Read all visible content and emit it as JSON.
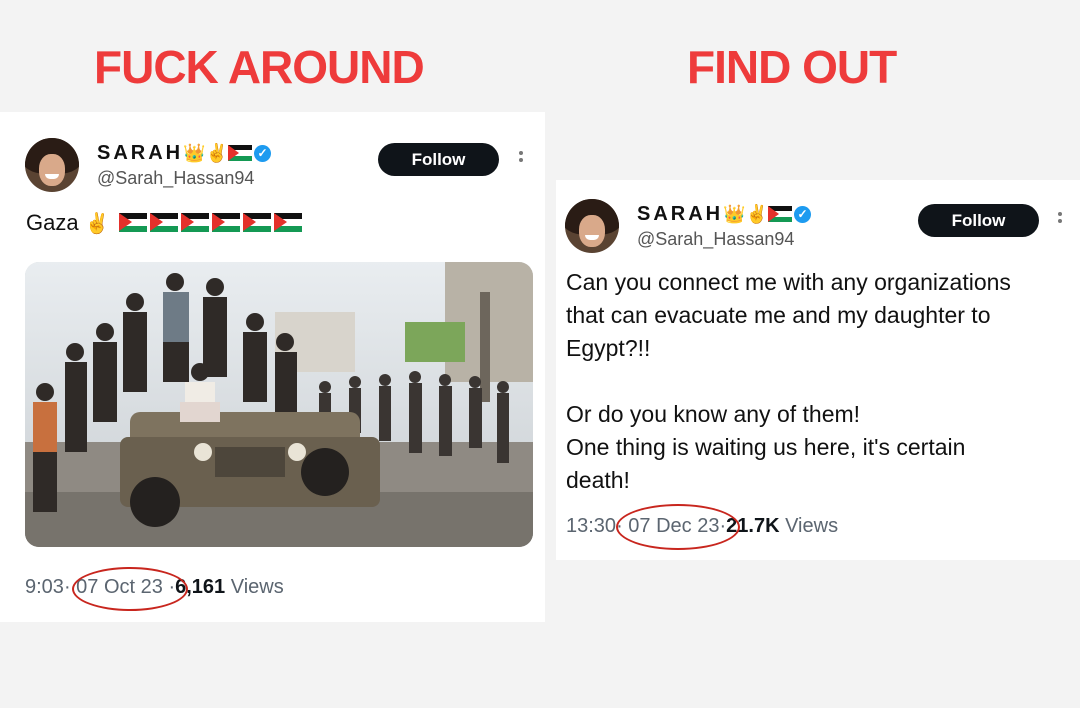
{
  "headlines": {
    "left": "FUCK AROUND",
    "right": "FIND OUT"
  },
  "left_tweet": {
    "name": "SARAH",
    "handle": "@Sarah_Hassan94",
    "follow_label": "Follow",
    "text": "Gaza",
    "time": "9:03",
    "date": "07 Oct 23",
    "views_count": "6,161",
    "views_label": "Views",
    "separator": "·"
  },
  "right_tweet": {
    "name": "SARAH",
    "handle": "@Sarah_Hassan94",
    "follow_label": "Follow",
    "text_lines": [
      "Can you connect me with any organizations",
      "that can evacuate me and my daughter to",
      "Egypt?!!",
      "Or do you know any of them!",
      "One thing is waiting us here, it's certain",
      "death!"
    ],
    "time": "13:30",
    "date": "07 Dec 23",
    "views_count": "21.7K",
    "views_label": "Views",
    "separator": "·"
  },
  "name_emojis": {
    "crown": "👑",
    "victory": "✌"
  },
  "verified_mark": "✓",
  "icons": [
    "verified-badge-icon",
    "palestine-flag-icon",
    "more-options-icon"
  ],
  "colors": {
    "headline_red": "#ee3b3b",
    "follow_button_bg": "#0f1419",
    "verified_blue": "#1d9bf0",
    "annotation_circle": "#c8261e"
  }
}
